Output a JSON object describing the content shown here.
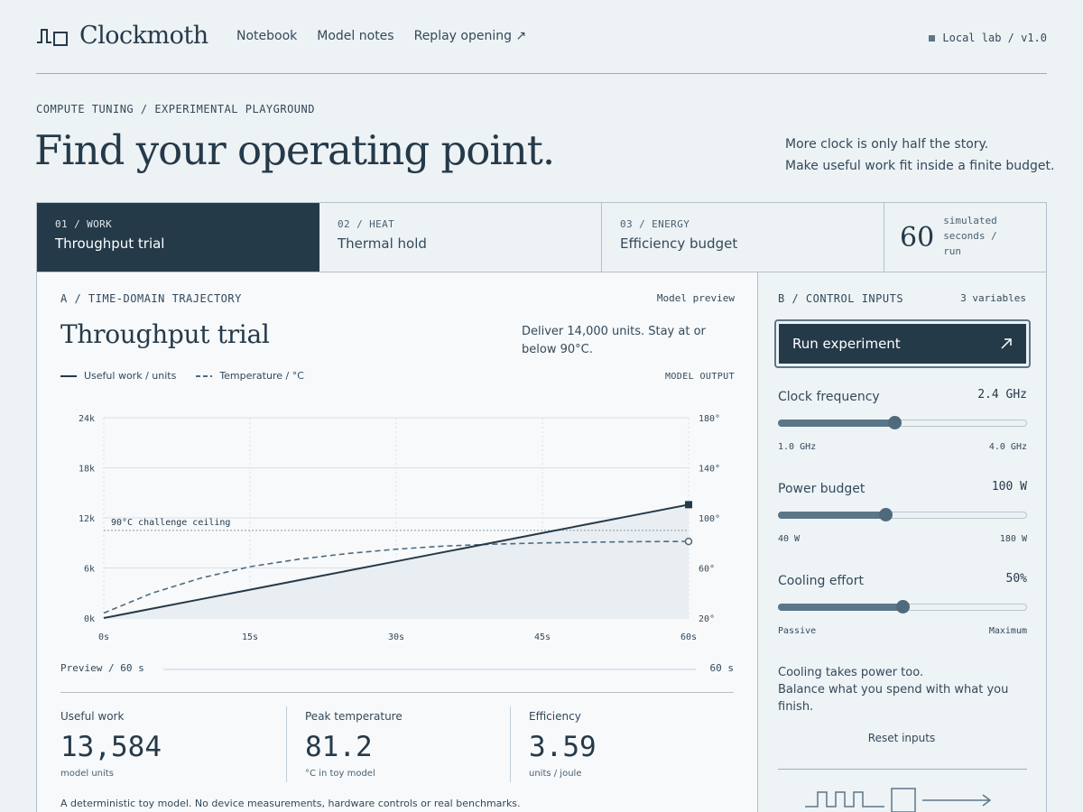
{
  "brand": {
    "name": "Clockmoth",
    "mark_icon": "square-wave-logo-icon"
  },
  "nav": {
    "items": [
      "Notebook",
      "Model notes",
      "Replay opening ↗"
    ]
  },
  "env": {
    "label": "Local lab / v1.0"
  },
  "hero": {
    "eyebrow": "COMPUTE TUNING / EXPERIMENTAL PLAYGROUND",
    "title": "Find your operating point.",
    "subtitle_line1": "More clock is only half the story.",
    "subtitle_line2": "Make useful work fit inside a finite budget."
  },
  "tabs": [
    {
      "num": "01 / WORK",
      "label": "Throughput trial",
      "active": true
    },
    {
      "num": "02 / HEAT",
      "label": "Thermal hold",
      "active": false
    },
    {
      "num": "03 / ENERGY",
      "label": "Efficiency budget",
      "active": false
    }
  ],
  "run": {
    "value": "60",
    "label_line1": "simulated",
    "label_line2": "seconds /",
    "label_line3": "run"
  },
  "panel_a": {
    "eyebrow": "A / TIME-DOMAIN TRAJECTORY",
    "preview_label": "Model preview",
    "title": "Throughput trial",
    "goal": "Deliver 14,000 units. Stay at or below 90°C.",
    "model_output": "MODEL OUTPUT",
    "preview_left": "Preview / 60 s",
    "preview_right": "60 s",
    "disclaimer": "A deterministic toy model. No device measurements, hardware controls or real benchmarks."
  },
  "chart_data": {
    "type": "line",
    "x": [
      0,
      5,
      10,
      15,
      20,
      25,
      30,
      35,
      40,
      45,
      50,
      55,
      60
    ],
    "x_ticks": [
      "0s",
      "15s",
      "30s",
      "45s",
      "60s"
    ],
    "x_tick_values": [
      0,
      15,
      30,
      45,
      60
    ],
    "xlim": [
      0,
      60
    ],
    "y_left_ticks": [
      "0k",
      "6k",
      "12k",
      "18k",
      "24k"
    ],
    "y_left_tick_values": [
      0,
      6000,
      12000,
      18000,
      24000
    ],
    "ylim_left": [
      0,
      24000
    ],
    "y_right_ticks": [
      "20°",
      "60°",
      "100°",
      "140°",
      "180°"
    ],
    "y_right_tick_values": [
      20,
      60,
      100,
      140,
      180
    ],
    "ylim_right": [
      20,
      180
    ],
    "series": [
      {
        "name": "Useful work / units",
        "axis": "left",
        "style": "solid",
        "values": [
          0,
          1132,
          2264,
          3396,
          4528,
          5660,
          6792,
          7924,
          9056,
          10188,
          11320,
          12452,
          13584
        ]
      },
      {
        "name": "Temperature / °C",
        "axis": "right",
        "style": "dashed",
        "values": [
          24,
          40,
          52,
          61,
          67,
          71.5,
          75,
          77.5,
          79,
          80,
          80.6,
          81,
          81.2
        ]
      }
    ],
    "threshold": {
      "label": "90°C challenge ceiling",
      "value": 90,
      "axis": "right"
    },
    "grid": true,
    "legend": "top-left"
  },
  "metrics": [
    {
      "label": "Useful work",
      "value": "13,584",
      "unit": "model units"
    },
    {
      "label": "Peak temperature",
      "value": "81.2",
      "unit": "°C in toy model"
    },
    {
      "label": "Efficiency",
      "value": "3.59",
      "unit": "units / joule"
    }
  ],
  "panel_b": {
    "eyebrow": "B / CONTROL INPUTS",
    "count": "3 variables",
    "run_button": "Run experiment",
    "run_icon": "arrow-up-right-icon",
    "note_line1": "Cooling takes power too.",
    "note_line2": "Balance what you spend with what you finish.",
    "reset": "Reset inputs"
  },
  "controls": [
    {
      "label": "Clock frequency",
      "value": "2.4 GHz",
      "min_label": "1.0 GHz",
      "max_label": "4.0 GHz",
      "fraction": 0.467
    },
    {
      "label": "Power budget",
      "value": "100 W",
      "min_label": "40 W",
      "max_label": "180 W",
      "fraction": 0.429
    },
    {
      "label": "Cooling effort",
      "value": "50%",
      "min_label": "Passive",
      "max_label": "Maximum",
      "fraction": 0.5
    }
  ],
  "colors": {
    "ink": "#253a49",
    "accent": "#5b7689",
    "background": "#edf2f5"
  }
}
